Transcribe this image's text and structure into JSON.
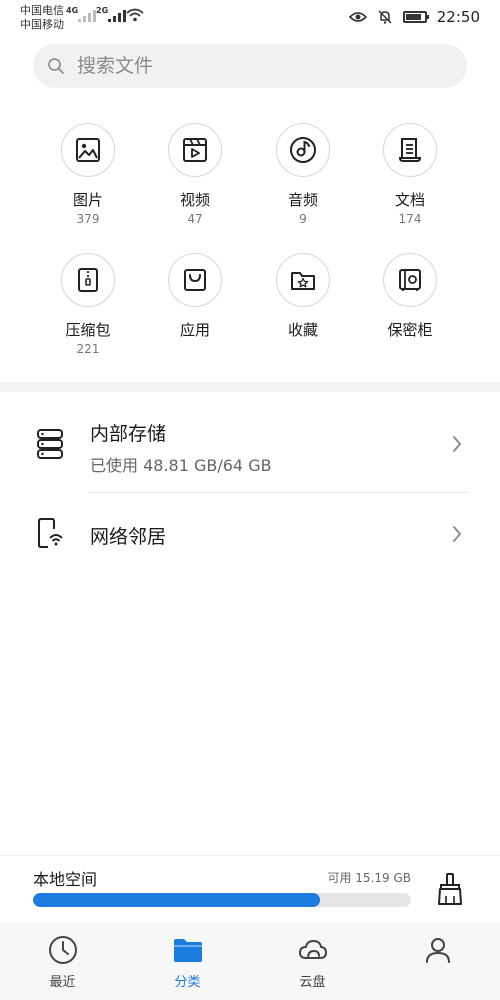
{
  "status_bar": {
    "carrier_1": "中国电信",
    "carrier_2": "中国移动",
    "net_1": "4G",
    "net_2": "2G",
    "time": "22:50"
  },
  "search": {
    "placeholder": "搜索文件"
  },
  "categories": [
    {
      "label": "图片",
      "count": "379",
      "icon": "image-icon"
    },
    {
      "label": "视频",
      "count": "47",
      "icon": "video-icon"
    },
    {
      "label": "音频",
      "count": "9",
      "icon": "music-icon"
    },
    {
      "label": "文档",
      "count": "174",
      "icon": "document-icon"
    },
    {
      "label": "压缩包",
      "count": "221",
      "icon": "zip-icon"
    },
    {
      "label": "应用",
      "count": "",
      "icon": "app-bag-icon"
    },
    {
      "label": "收藏",
      "count": "",
      "icon": "star-folder-icon"
    },
    {
      "label": "保密柜",
      "count": "",
      "icon": "safe-icon"
    }
  ],
  "storage": {
    "internal_title": "内部存储",
    "internal_usage": "已使用 48.81 GB/64 GB",
    "network_title": "网络邻居"
  },
  "local_space": {
    "title": "本地空间",
    "free": "可用 15.19 GB",
    "used_fraction": 0.76
  },
  "tabs": [
    {
      "label": "最近",
      "icon": "clock-icon"
    },
    {
      "label": "分类",
      "icon": "folder-icon"
    },
    {
      "label": "云盘",
      "icon": "cloud-icon"
    }
  ],
  "colors": {
    "accent": "#1a7ddf"
  }
}
